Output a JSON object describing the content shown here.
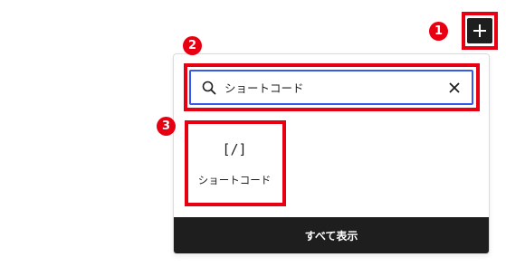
{
  "toolbar": {
    "add_block_icon": "plus-icon"
  },
  "annotations": {
    "badge_1": "1",
    "badge_2": "2",
    "badge_3": "3",
    "highlight_color": "#e60012"
  },
  "inserter": {
    "search": {
      "value": "ショートコード",
      "search_icon": "search-icon",
      "clear_icon": "close-icon",
      "focus_color": "#3858e9"
    },
    "results": [
      {
        "icon_text": "[/]",
        "label": "ショートコード"
      }
    ],
    "browse_all_label": "すべて表示"
  }
}
